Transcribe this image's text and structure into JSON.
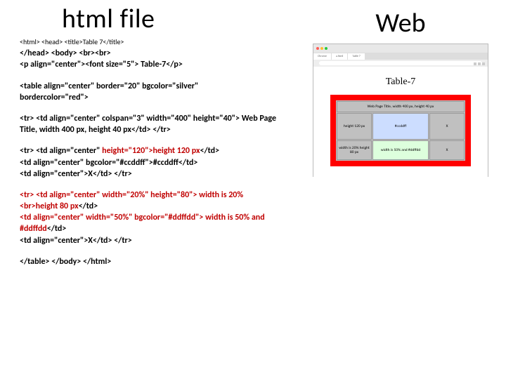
{
  "left": {
    "title": "html file",
    "line1": "<html> <head> <title>Table 7</title>",
    "line2": "</head> <body>  <br><br>",
    "line3": "<p align=\"center\"><font size=\"5\"> Table-7</p>",
    "block2a": "<table align=\"center\" border=\"20\" bgcolor=\"silver\"",
    "block2b": "bordercolor=\"red\">",
    "block3a": "<tr> <td align=\"center\" colspan=\"3\" width=\"400\" height=\"40\"> ",
    "block3b": "Web Page Title, width 400 px, height 40 px",
    "block3c": "</td> </tr>",
    "block4a": " <tr> <td align=\"center\" ",
    "block4b": "height=\"120\">height 120 px",
    "block4c": "</td>",
    "block4d": "<td align=\"center\" bgcolor=\"#ccddff\">#ccddff</td>",
    "block4e": "<td align=\"center\">X</td> </tr>",
    "block5a": "<tr> <td align=\"center\" width=\"20%\" height=\"80\"> width is 20% <br>height 80 px",
    "block5b": "</td>",
    "block5c": "<td align=\"center\" width=\"50%\" bgcolor=\"#ddffdd\"> width is 50% and #ddffdd",
    "block5d": "</td>",
    "block5e": "<td align=\"center\">X</td> </tr>",
    "block6": "</table> </body> </html>"
  },
  "right": {
    "title": "Web",
    "tab1": "Chrome",
    "tab2": "a.html",
    "tab3": "Table 7",
    "table_heading": "Table-7",
    "cell_header": "Web Page Title, width 400 px, height 40 px",
    "cell_h120": "height 120 px",
    "cell_blue": "#ccddff",
    "cell_x1": "X",
    "cell_r3a": "width is 20% height 80 px",
    "cell_green": "width is 50% and #ddffdd",
    "cell_x2": "X"
  }
}
